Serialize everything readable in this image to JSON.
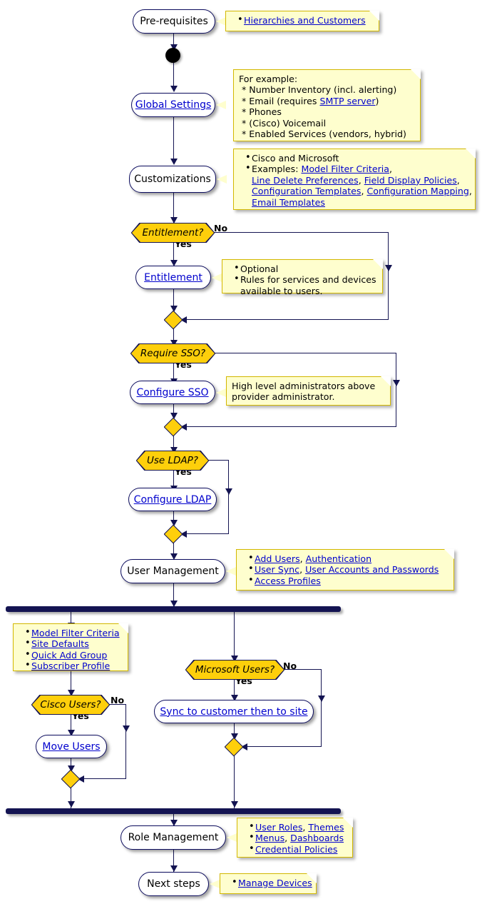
{
  "diagram": {
    "title": "Provider / Customer Setup Activity Diagram",
    "colors": {
      "activity_fill": "#FFFFFF",
      "activity_border": "#0C0C5E",
      "decision_fill": "#FECF0B",
      "note_fill": "#FEFECE",
      "note_border": "#D3B800",
      "link": "#0000CD",
      "line": "#141452",
      "bar": "#141452"
    }
  },
  "nodes": {
    "prerequisites": {
      "label": "Pre-requisites",
      "type": "activity",
      "link": false
    },
    "start": {
      "label": "",
      "type": "start-node"
    },
    "global_settings": {
      "label": "Global Settings",
      "type": "activity",
      "link": true
    },
    "customizations": {
      "label": "Customizations",
      "type": "activity",
      "link": false
    },
    "entitlement_decision": {
      "label": "Entitlement?",
      "type": "decision"
    },
    "entitlement": {
      "label": "Entitlement",
      "type": "activity",
      "link": true
    },
    "merge_entitlement": {
      "label": "",
      "type": "merge"
    },
    "sso_decision": {
      "label": "Require SSO?",
      "type": "decision"
    },
    "configure_sso": {
      "label": "Configure SSO",
      "type": "activity",
      "link": true
    },
    "merge_sso": {
      "label": "",
      "type": "merge"
    },
    "ldap_decision": {
      "label": "Use LDAP?",
      "type": "decision"
    },
    "configure_ldap": {
      "label": "Configure LDAP",
      "type": "activity",
      "link": true
    },
    "merge_ldap": {
      "label": "",
      "type": "merge"
    },
    "user_management": {
      "label": "User Management",
      "type": "activity",
      "link": false
    },
    "fork": {
      "label": "",
      "type": "fork-bar"
    },
    "cisco_users_decision": {
      "label": "Cisco Users?",
      "type": "decision"
    },
    "move_users": {
      "label": "Move Users",
      "type": "activity",
      "link": true
    },
    "merge_cisco": {
      "label": "",
      "type": "merge"
    },
    "microsoft_users_decision": {
      "label": "Microsoft Users?",
      "type": "decision"
    },
    "sync_to_customer": {
      "label": "Sync to customer then to site",
      "type": "activity",
      "link": true
    },
    "merge_microsoft": {
      "label": "",
      "type": "merge"
    },
    "join": {
      "label": "",
      "type": "join-bar"
    },
    "role_management": {
      "label": "Role Management",
      "type": "activity",
      "link": false
    },
    "next_steps": {
      "label": "Next steps",
      "type": "activity",
      "link": false
    }
  },
  "edge_labels": {
    "entitlement_no": "No",
    "entitlement_yes": "Yes",
    "sso_yes": "Yes",
    "ldap_yes": "Yes",
    "cisco_no": "No",
    "cisco_yes": "Yes",
    "microsoft_no": "No",
    "microsoft_yes": "Yes"
  },
  "notes": {
    "prerequisites": {
      "items": [
        {
          "parts": [
            {
              "text": "Hierarchies and Customers",
              "link": true
            }
          ]
        }
      ]
    },
    "global_settings": {
      "lines": [
        {
          "parts": [
            {
              "text": "For example:",
              "link": false
            }
          ]
        },
        {
          "parts": [
            {
              "text": " * Number Inventory (incl. alerting)",
              "link": false
            }
          ]
        },
        {
          "parts": [
            {
              "text": " * Email (requires ",
              "link": false
            },
            {
              "text": "SMTP server",
              "link": true
            },
            {
              "text": ")",
              "link": false
            }
          ]
        },
        {
          "parts": [
            {
              "text": " * Phones",
              "link": false
            }
          ]
        },
        {
          "parts": [
            {
              "text": " * (Cisco) Voicemail",
              "link": false
            }
          ]
        },
        {
          "parts": [
            {
              "text": " * Enabled Services (vendors, hybrid)",
              "link": false
            }
          ]
        }
      ]
    },
    "customizations": {
      "items": [
        {
          "parts": [
            {
              "text": "Cisco and Microsoft",
              "link": false
            }
          ]
        },
        {
          "parts": [
            {
              "text": "Examples: ",
              "link": false
            },
            {
              "text": "Model Filter Criteria",
              "link": true
            },
            {
              "text": ",",
              "link": false
            },
            {
              "text": "\n",
              "link": false
            },
            {
              "text": "Line Delete Preferences",
              "link": true
            },
            {
              "text": ", ",
              "link": false
            },
            {
              "text": "Field Display Policies",
              "link": true
            },
            {
              "text": ",",
              "link": false
            },
            {
              "text": "\n",
              "link": false
            },
            {
              "text": "Configuration Templates",
              "link": true
            },
            {
              "text": ", ",
              "link": false
            },
            {
              "text": "Configuration Mapping",
              "link": true
            },
            {
              "text": ",",
              "link": false
            },
            {
              "text": "\n",
              "link": false
            },
            {
              "text": "Email Templates",
              "link": true
            }
          ]
        }
      ]
    },
    "entitlement": {
      "items": [
        {
          "parts": [
            {
              "text": "Optional",
              "link": false
            }
          ]
        },
        {
          "parts": [
            {
              "text": "Rules for services and devices",
              "link": false
            },
            {
              "text": "\n",
              "link": false
            },
            {
              "text": "available to users.",
              "link": false
            }
          ]
        }
      ]
    },
    "configure_sso": {
      "lines": [
        {
          "parts": [
            {
              "text": "High level administrators above",
              "link": false
            }
          ]
        },
        {
          "parts": [
            {
              "text": "provider administrator.",
              "link": false
            }
          ]
        }
      ]
    },
    "user_management": {
      "items": [
        {
          "parts": [
            {
              "text": "Add Users",
              "link": true
            },
            {
              "text": ", ",
              "link": false
            },
            {
              "text": "Authentication",
              "link": true
            }
          ]
        },
        {
          "parts": [
            {
              "text": "User Sync",
              "link": true
            },
            {
              "text": ", ",
              "link": false
            },
            {
              "text": "User Accounts and Passwords",
              "link": true
            }
          ]
        },
        {
          "parts": [
            {
              "text": "Access Profiles",
              "link": true
            }
          ]
        }
      ]
    },
    "left_branch": {
      "items": [
        {
          "parts": [
            {
              "text": "Model Filter Criteria",
              "link": true
            }
          ]
        },
        {
          "parts": [
            {
              "text": "Site Defaults",
              "link": true
            }
          ]
        },
        {
          "parts": [
            {
              "text": "Quick Add Group",
              "link": true
            }
          ]
        },
        {
          "parts": [
            {
              "text": "Subscriber Profile",
              "link": true
            }
          ]
        }
      ]
    },
    "role_management": {
      "items": [
        {
          "parts": [
            {
              "text": "User Roles",
              "link": true
            },
            {
              "text": ", ",
              "link": false
            },
            {
              "text": "Themes",
              "link": true
            }
          ]
        },
        {
          "parts": [
            {
              "text": "Menus",
              "link": true
            },
            {
              "text": ", ",
              "link": false
            },
            {
              "text": "Dashboards",
              "link": true
            }
          ]
        },
        {
          "parts": [
            {
              "text": "Credential Policies",
              "link": true
            }
          ]
        }
      ]
    },
    "next_steps": {
      "items": [
        {
          "parts": [
            {
              "text": "Manage Devices",
              "link": true
            }
          ]
        }
      ]
    }
  }
}
